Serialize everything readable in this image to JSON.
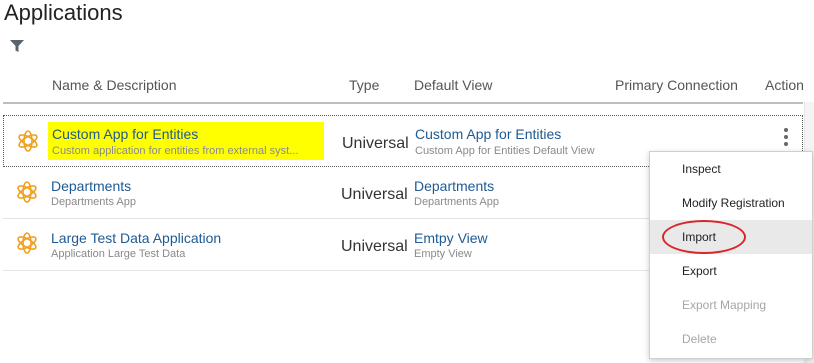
{
  "page": {
    "title": "Applications"
  },
  "toolbar": {
    "filter_icon": "filter-icon"
  },
  "table": {
    "headers": {
      "name": "Name & Description",
      "type": "Type",
      "view": "Default View",
      "connection": "Primary Connection",
      "action": "Action"
    },
    "rows": [
      {
        "name": "Custom App for Entities",
        "desc": "Custom application for entities from external syst...",
        "type": "Universal",
        "view": "Custom App for Entities",
        "view_desc": "Custom App for Entities Default View",
        "selected": true,
        "highlight": "#ffff00"
      },
      {
        "name": "Departments",
        "desc": "Departments App",
        "type": "Universal",
        "view": "Departments",
        "view_desc": "Departments App"
      },
      {
        "name": "Large Test Data Application",
        "desc": "Application Large Test Data",
        "type": "Universal",
        "view": "Emtpy View",
        "view_desc": "Empty View"
      }
    ]
  },
  "menu": {
    "items": [
      {
        "label": "Inspect",
        "enabled": true
      },
      {
        "label": "Modify Registration",
        "enabled": true
      },
      {
        "label": "Import",
        "enabled": true,
        "hovered": true,
        "annotated": true
      },
      {
        "label": "Export",
        "enabled": true
      },
      {
        "label": "Export Mapping",
        "enabled": false
      },
      {
        "label": "Delete",
        "enabled": false
      }
    ]
  },
  "colors": {
    "link": "#1e5a93",
    "icon": "#f0a020",
    "annotation": "#d9252a",
    "highlight": "#ffff00"
  }
}
